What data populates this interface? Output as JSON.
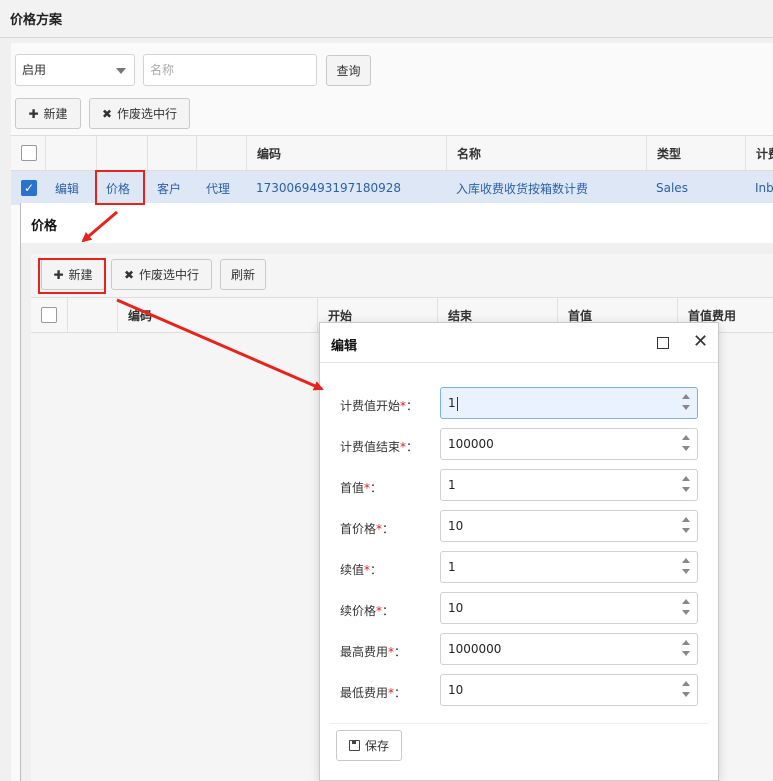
{
  "page": {
    "title": "价格方案"
  },
  "filters": {
    "status_value": "启用",
    "name_placeholder": "名称",
    "query_label": "查询"
  },
  "toolbar": {
    "new_label": "新建",
    "void_label": "作废选中行"
  },
  "main_table": {
    "columns": [
      "编码",
      "名称",
      "类型",
      "计费"
    ],
    "row": {
      "actions": [
        "编辑",
        "价格",
        "客户",
        "代理"
      ],
      "code": "1730069493197180928",
      "name": "入库收费收货按箱数计费",
      "type": "Sales",
      "billing": "Inb"
    }
  },
  "price_dialog": {
    "title": "价格",
    "new_label": "新建",
    "void_label": "作废选中行",
    "refresh_label": "刷新",
    "columns": [
      "编码",
      "开始",
      "结束",
      "首值",
      "首值费用"
    ]
  },
  "edit_dialog": {
    "title": "编辑",
    "fields": [
      {
        "label": "计费值开始",
        "value": "1"
      },
      {
        "label": "计费值结束",
        "value": "100000"
      },
      {
        "label": "首值",
        "value": "1"
      },
      {
        "label": "首价格",
        "value": "10"
      },
      {
        "label": "续值",
        "value": "1"
      },
      {
        "label": "续价格",
        "value": "10"
      },
      {
        "label": "最高费用",
        "value": "1000000"
      },
      {
        "label": "最低费用",
        "value": "10"
      }
    ],
    "required_mark": "*",
    "label_suffix": "：",
    "save_label": "保存"
  },
  "colors": {
    "accent": "#2a71d0",
    "link": "#2b5fa8",
    "selected_row": "#dde7f6",
    "annotation": "#e8231b",
    "required": "#e02020"
  },
  "icons": [
    "chevron-down-icon",
    "plus-icon",
    "x-icon",
    "checkbox-checked-icon",
    "maximize-icon",
    "close-icon",
    "save-icon",
    "spinner-up-icon",
    "spinner-down-icon"
  ]
}
